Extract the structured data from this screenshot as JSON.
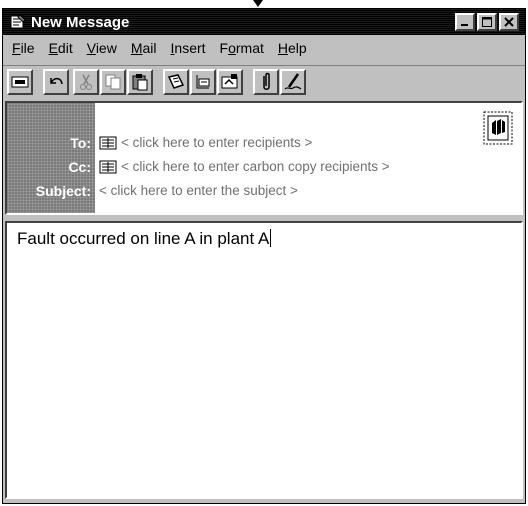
{
  "window": {
    "title": "New Message"
  },
  "menu": {
    "file": {
      "label": "ile",
      "mnemonic": "F"
    },
    "edit": {
      "label": "dit",
      "mnemonic": "E"
    },
    "view": {
      "label": "iew",
      "mnemonic": "V"
    },
    "mail": {
      "label": "ail",
      "mnemonic": "M"
    },
    "insert": {
      "label": "nsert",
      "mnemonic": "I"
    },
    "format_pre": "F",
    "format_mn": "o",
    "format_post": "rmat",
    "help": {
      "label": "elp",
      "mnemonic": "H"
    }
  },
  "toolbar": {
    "icons": [
      "send-icon",
      "undo-icon",
      "cut-icon",
      "copy-icon",
      "paste-icon",
      "address-book-icon",
      "check-names-icon",
      "select-names-icon",
      "attach-icon",
      "signature-icon"
    ]
  },
  "header": {
    "to_label": "To:",
    "cc_label": "Cc:",
    "subject_label": "Subject:",
    "to_placeholder": "< click here to enter recipients >",
    "cc_placeholder": "< click here to enter carbon copy recipients >",
    "subject_placeholder": "< click here to enter the subject >"
  },
  "body": {
    "text": "Fault occurred on line A in plant A"
  },
  "colors": {
    "title_bar": "#000000",
    "chrome": "#c0c0c0",
    "label_panel": "#7a7a7a",
    "placeholder": "#707070"
  }
}
